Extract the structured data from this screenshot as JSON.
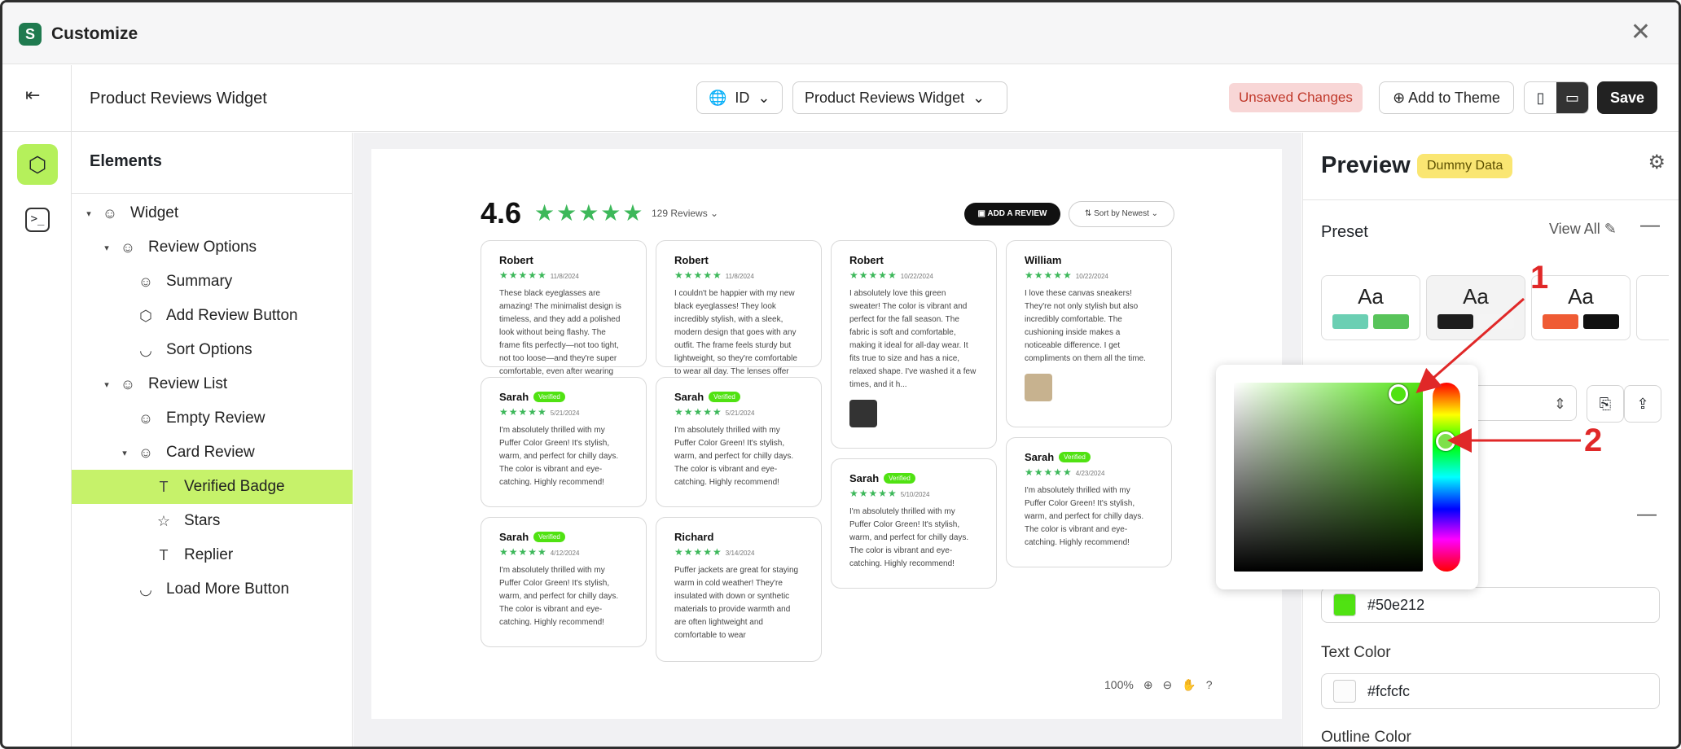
{
  "app": {
    "title": "Customize",
    "close_icon": "close-icon"
  },
  "topbar": {
    "widget_title": "Product Reviews Widget",
    "language": "ID",
    "widget_select": "Product Reviews Widget",
    "unsaved": "Unsaved Changes",
    "add_to_theme": "Add to Theme",
    "save": "Save"
  },
  "elements": {
    "heading": "Elements",
    "tree": [
      {
        "label": "Widget"
      },
      {
        "label": "Review Options"
      },
      {
        "label": "Summary"
      },
      {
        "label": "Add Review Button"
      },
      {
        "label": "Sort Options"
      },
      {
        "label": "Review List"
      },
      {
        "label": "Empty Review"
      },
      {
        "label": "Card Review"
      },
      {
        "label": "Verified Badge"
      },
      {
        "label": "Stars"
      },
      {
        "label": "Replier"
      },
      {
        "label": "Load More Button"
      }
    ]
  },
  "summary": {
    "rating": "4.6",
    "stars": "★★★★★",
    "reviews": "129 Reviews",
    "add_review": "ADD A REVIEW",
    "sort": "Sort by Newest"
  },
  "reviews": [
    {
      "name": "Robert",
      "date": "11/8/2024",
      "text": "These black eyeglasses are amazing! The minimalist design is timeless, and they add a polished look without being flashy. The frame fits perfectly—not too tight, not too loose—and they're super comfortable, even after wearing them for hours. The qual..."
    },
    {
      "name": "Robert",
      "date": "11/8/2024",
      "text": "I couldn't be happier with my new black eyeglasses! They look incredibly stylish, with a sleek, modern design that goes with any outfit. The frame feels sturdy but lightweight, so they're comfortable to wear all day. The lenses offer clear vision wit..."
    },
    {
      "name": "Robert",
      "date": "10/22/2024",
      "text": "I absolutely love this green sweater! The color is vibrant and perfect for the fall season. The fabric is soft and comfortable, making it ideal for all-day wear. It fits true to size and has a nice, relaxed shape. I've washed it a few times, and it h..."
    },
    {
      "name": "William",
      "date": "10/22/2024",
      "text": "I love these canvas sneakers! They're not only stylish but also incredibly comfortable. The cushioning inside makes a noticeable difference. I get compliments on them all the time."
    },
    {
      "name": "Sarah",
      "badge": "Verified",
      "date": "5/21/2024",
      "text": "I'm absolutely thrilled with my Puffer Color Green! It's stylish, warm, and perfect for chilly days. The color is vibrant and eye-catching. Highly recommend!"
    },
    {
      "name": "Sarah",
      "badge": "Verified",
      "date": "5/21/2024",
      "text": "I'm absolutely thrilled with my Puffer Color Green! It's stylish, warm, and perfect for chilly days. The color is vibrant and eye-catching. Highly recommend!"
    },
    {
      "name": "Sarah",
      "badge": "Verified",
      "date": "5/10/2024",
      "text": "I'm absolutely thrilled with my Puffer Color Green! It's stylish, warm, and perfect for chilly days. The color is vibrant and eye-catching. Highly recommend!"
    },
    {
      "name": "Sarah",
      "badge": "Verified",
      "date": "4/23/2024",
      "text": "I'm absolutely thrilled with my Puffer Color Green! It's stylish, warm, and perfect for chilly days. The color is vibrant and eye-catching. Highly recommend!"
    },
    {
      "name": "Sarah",
      "badge": "Verified",
      "date": "4/12/2024",
      "text": "I'm absolutely thrilled with my Puffer Color Green! It's stylish, warm, and perfect for chilly days. The color is vibrant and eye-catching. Highly recommend!"
    },
    {
      "name": "Richard",
      "date": "3/14/2024",
      "text": "Puffer jackets are great for staying warm in cold weather! They're insulated with down or synthetic materials to provide warmth and are often lightweight and comfortable to wear"
    }
  ],
  "zoom": "100%",
  "preview": {
    "title": "Preview",
    "badge": "Dummy Data",
    "preset": "Preset",
    "view_all": "View All",
    "aa": "Aa"
  },
  "colors": {
    "background_hex": "#50e212",
    "text_label": "Text Color",
    "text_hex": "#fcfcfc",
    "outline_label": "Outline Color"
  },
  "annotations": {
    "one": "1",
    "two": "2"
  }
}
